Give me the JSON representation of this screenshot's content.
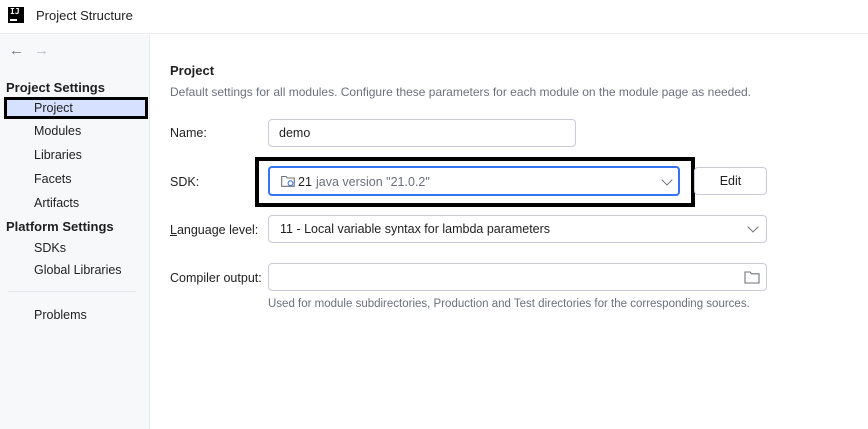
{
  "window": {
    "title": "Project Structure",
    "logo_text": "IJ"
  },
  "nav": {
    "back_glyph": "←",
    "forward_glyph": "→"
  },
  "sidebar": {
    "sections": [
      {
        "header": "Project Settings",
        "items": [
          "Project",
          "Modules",
          "Libraries",
          "Facets",
          "Artifacts"
        ]
      },
      {
        "header": "Platform Settings",
        "items": [
          "SDKs",
          "Global Libraries"
        ]
      }
    ],
    "problems": "Problems",
    "selected": "Project"
  },
  "main": {
    "title": "Project",
    "description": "Default settings for all modules. Configure these parameters for each module on the module page as needed.",
    "name": {
      "label": "Name:",
      "value": "demo"
    },
    "sdk": {
      "label": "SDK:",
      "version": "21",
      "description": "java version \"21.0.2\"",
      "edit_label": "Edit"
    },
    "language_level": {
      "label_mnemonic": "L",
      "label_rest": "anguage level:",
      "value": "11 - Local variable syntax for lambda parameters"
    },
    "compiler_output": {
      "label": "Compiler output:",
      "value": "",
      "hint": "Used for module subdirectories, Production and Test directories for the corresponding sources."
    }
  },
  "icons": {
    "app": "intellij-logo-icon",
    "sdk": "folder-java-icon",
    "browse": "folder-icon",
    "dropdown": "chevron-down-icon"
  },
  "colors": {
    "accent": "#3574f0",
    "selection": "#d5e1ff",
    "sidebar_bg": "#f7f8fa",
    "secondary_text": "#6c707e"
  }
}
